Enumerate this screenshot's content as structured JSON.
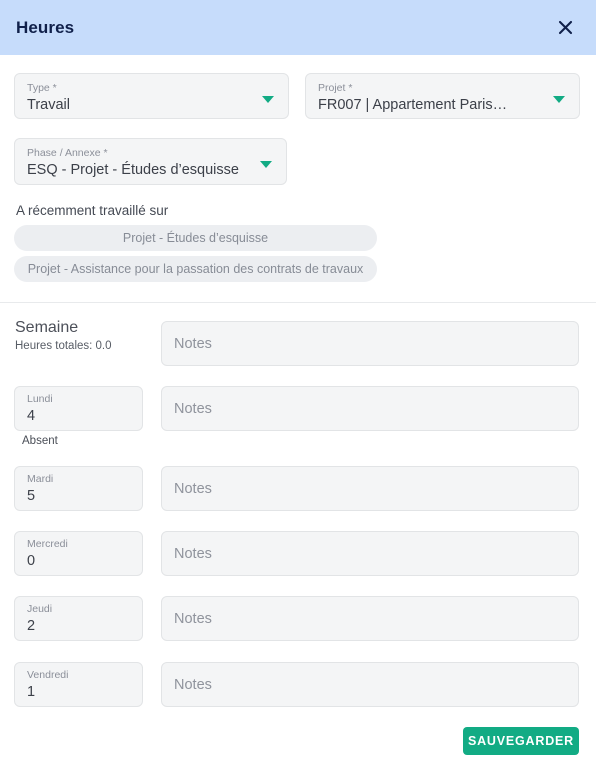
{
  "header": {
    "title": "Heures",
    "close_icon": "close-icon"
  },
  "form": {
    "type": {
      "label": "Type *",
      "value": "Travail",
      "caret_icon": "chevron-down-icon"
    },
    "projet": {
      "label": "Projet *",
      "value": "FR007 | Appartement Paris…",
      "caret_icon": "chevron-down-icon"
    },
    "phase": {
      "label": "Phase / Annexe *",
      "value": "ESQ - Projet - Études d’esquisse",
      "caret_icon": "chevron-down-icon"
    }
  },
  "recent": {
    "title": "A récemment travaillé sur",
    "chips": [
      "Projet - Études d’esquisse",
      "Projet - Assistance pour la passation des contrats de travaux"
    ]
  },
  "week": {
    "title": "Semaine",
    "total_label": "Heures totales: 0.0",
    "notes_placeholder": "Notes",
    "week_notes_value": "",
    "days": [
      {
        "label": "Lundi",
        "value": "4",
        "notes": "",
        "status": "Absent"
      },
      {
        "label": "Mardi",
        "value": "5",
        "notes": ""
      },
      {
        "label": "Mercredi",
        "value": "0",
        "notes": ""
      },
      {
        "label": "Jeudi",
        "value": "2",
        "notes": ""
      },
      {
        "label": "Vendredi",
        "value": "1",
        "notes": ""
      }
    ]
  },
  "footer": {
    "save_label": "SAUVEGARDER"
  },
  "colors": {
    "header_bg": "#c6dcfb",
    "accent": "#12ab84",
    "field_bg": "#f4f5f6",
    "chip_bg": "#eceef1",
    "title_text": "#10204a"
  }
}
